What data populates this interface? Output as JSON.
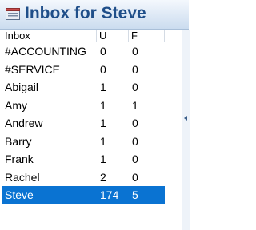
{
  "window": {
    "title": "Inbox for Steve"
  },
  "list": {
    "columns": {
      "inbox": "Inbox",
      "u": "U",
      "f": "F"
    },
    "rows": [
      {
        "name": "#ACCOUNTING",
        "u": "0",
        "f": "0",
        "selected": false
      },
      {
        "name": "#SERVICE",
        "u": "0",
        "f": "0",
        "selected": false
      },
      {
        "name": "Abigail",
        "u": "1",
        "f": "0",
        "selected": false
      },
      {
        "name": "Amy",
        "u": "1",
        "f": "1",
        "selected": false
      },
      {
        "name": "Andrew",
        "u": "1",
        "f": "0",
        "selected": false
      },
      {
        "name": "Barry",
        "u": "1",
        "f": "0",
        "selected": false
      },
      {
        "name": "Frank",
        "u": "1",
        "f": "0",
        "selected": false
      },
      {
        "name": "Rachel",
        "u": "2",
        "f": "0",
        "selected": false
      },
      {
        "name": "Steve",
        "u": "174",
        "f": "5",
        "selected": true
      }
    ]
  },
  "colors": {
    "title_text": "#1f4e89",
    "selection": "#0a73d2"
  },
  "icons": {
    "title": "inbox-icon",
    "scroll": "chevron-left-icon"
  }
}
